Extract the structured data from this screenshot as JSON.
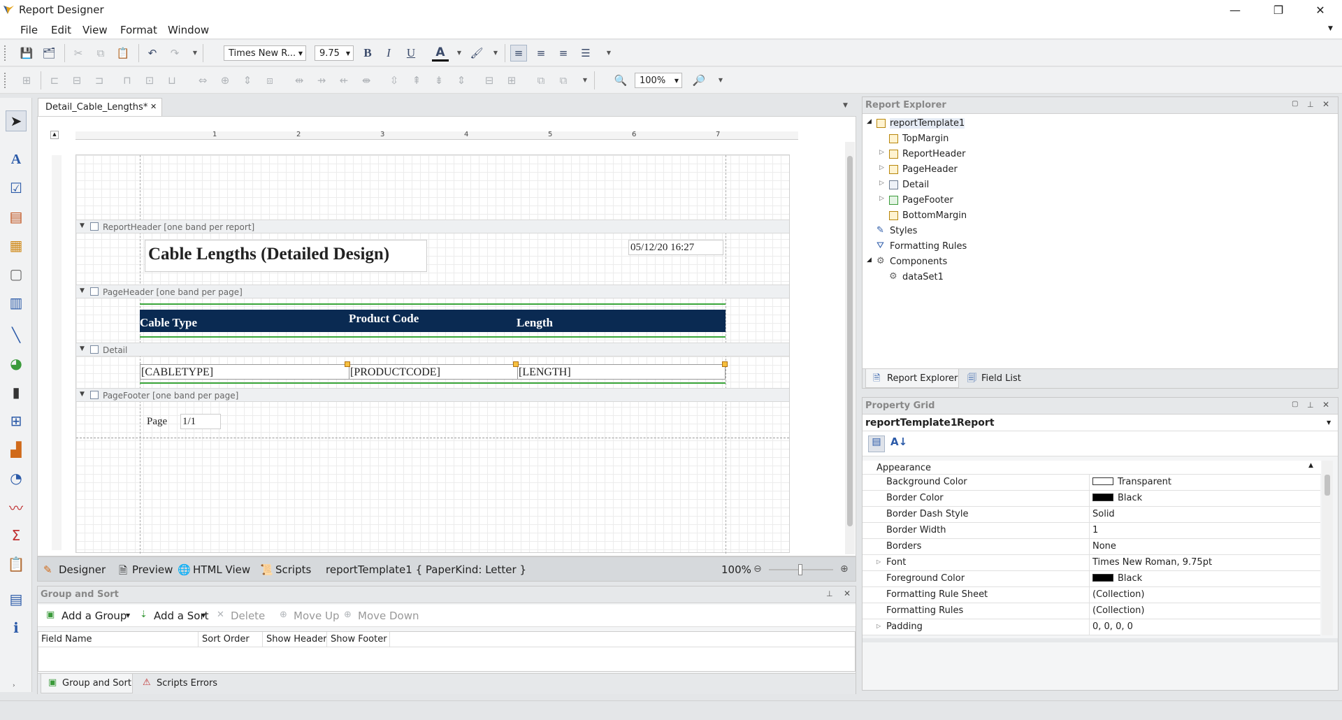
{
  "window": {
    "title": "Report Designer",
    "minimize": "—",
    "restore": "❐",
    "close": "✕"
  },
  "menu": {
    "items": [
      "File",
      "Edit",
      "View",
      "Format",
      "Window"
    ]
  },
  "toolbar": {
    "font_family": "Times New R...",
    "font_size": "9.75",
    "bold": "B",
    "italic": "I",
    "underline": "U",
    "fore_color": "A",
    "zoom": "100%"
  },
  "document": {
    "tab_label": "Detail_Cable_Lengths*",
    "tab_close": "✕"
  },
  "ruler": {
    "marks": [
      "1",
      "2",
      "3",
      "4",
      "5",
      "6",
      "7"
    ]
  },
  "bands": {
    "report_header": "ReportHeader [one band per report]",
    "page_header": "PageHeader [one band per page]",
    "detail": "Detail",
    "page_footer": "PageFooter [one band per page]"
  },
  "report": {
    "title": "Cable Lengths (Detailed Design)",
    "date": "05/12/20 16:27",
    "col_cable_type": "Cable Type",
    "col_product_code": "Product Code",
    "col_length": "Length",
    "field_cabletype": "[CABLETYPE]",
    "field_productcode": "[PRODUCTCODE]",
    "field_length": "[LENGTH]",
    "page_label": "Page",
    "page_value": "1/1",
    "header_bg": "#0a2a52",
    "rule_green": "#3aa63a"
  },
  "designer_tabs": {
    "designer": "Designer",
    "preview": "Preview",
    "html_view": "HTML View",
    "scripts": "Scripts",
    "info": "reportTemplate1 { PaperKind: Letter }",
    "zoom": "100%"
  },
  "group_sort": {
    "title": "Group and Sort",
    "add_group": "Add a Group",
    "add_sort": "Add a Sort",
    "delete": "Delete",
    "move_up": "Move Up",
    "move_down": "Move Down",
    "columns": [
      "Field Name",
      "Sort Order",
      "Show Header",
      "Show Footer"
    ],
    "tab_group_sort": "Group and Sort",
    "tab_scripts_errors": "Scripts Errors"
  },
  "report_explorer": {
    "title": "Report Explorer",
    "root": "reportTemplate1",
    "items": [
      "TopMargin",
      "ReportHeader",
      "PageHeader",
      "Detail",
      "PageFooter",
      "BottomMargin"
    ],
    "styles": "Styles",
    "formatting_rules": "Formatting Rules",
    "components": "Components",
    "dataset": "dataSet1",
    "tab_explorer": "Report Explorer",
    "tab_field_list": "Field List"
  },
  "property_grid": {
    "title": "Property Grid",
    "object_name": "reportTemplate1",
    "object_type": "Report",
    "category": "Appearance",
    "rows": [
      {
        "name": "Background Color",
        "value": "Transparent"
      },
      {
        "name": "Border Color",
        "value": "Black"
      },
      {
        "name": "Border Dash Style",
        "value": "Solid"
      },
      {
        "name": "Border Width",
        "value": "1"
      },
      {
        "name": "Borders",
        "value": "None"
      },
      {
        "name": "Font",
        "value": "Times New Roman, 9.75pt"
      },
      {
        "name": "Foreground Color",
        "value": "Black"
      },
      {
        "name": "Formatting Rule Sheet",
        "value": "(Collection)"
      },
      {
        "name": "Formatting Rules",
        "value": "(Collection)"
      },
      {
        "name": "Padding",
        "value": "0, 0, 0, 0"
      }
    ]
  }
}
